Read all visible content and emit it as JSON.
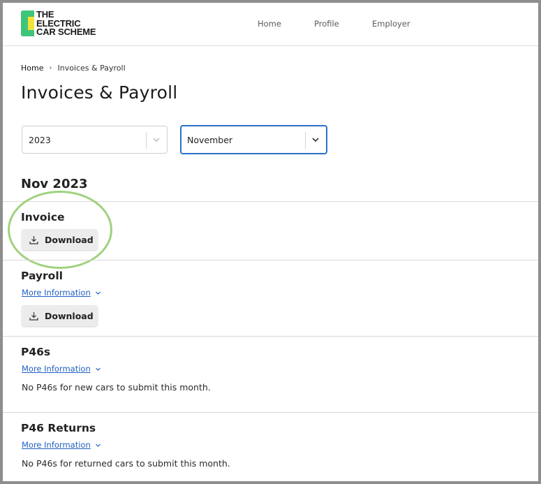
{
  "header": {
    "logo_lines": [
      "THE",
      "ELECTRIC",
      "CAR SCHEME"
    ],
    "nav": [
      {
        "label": "Home"
      },
      {
        "label": "Profile"
      },
      {
        "label": "Employer"
      }
    ]
  },
  "breadcrumb": {
    "home": "Home",
    "separator": "›",
    "current": "Invoices & Payroll"
  },
  "page_title": "Invoices & Payroll",
  "filters": {
    "year": "2023",
    "month": "November"
  },
  "period_heading": "Nov 2023",
  "sections": {
    "invoice": {
      "title": "Invoice",
      "download_label": "Download"
    },
    "payroll": {
      "title": "Payroll",
      "more_info": "More Information",
      "download_label": "Download"
    },
    "p46s": {
      "title": "P46s",
      "more_info": "More Information",
      "message": "No P46s for new cars to submit this month."
    },
    "p46_returns": {
      "title": "P46 Returns",
      "more_info": "More Information",
      "message": "No P46s for returned cars to submit this month."
    }
  },
  "colors": {
    "brand_green": "#3fc57a",
    "brand_yellow": "#f2e23a",
    "link_blue": "#1f5fc0",
    "focus_blue": "#2a6fc9",
    "highlight_ring": "#9fd17e"
  },
  "icons": [
    "download-icon",
    "chevron-down-icon",
    "breadcrumb-chevron-icon"
  ]
}
